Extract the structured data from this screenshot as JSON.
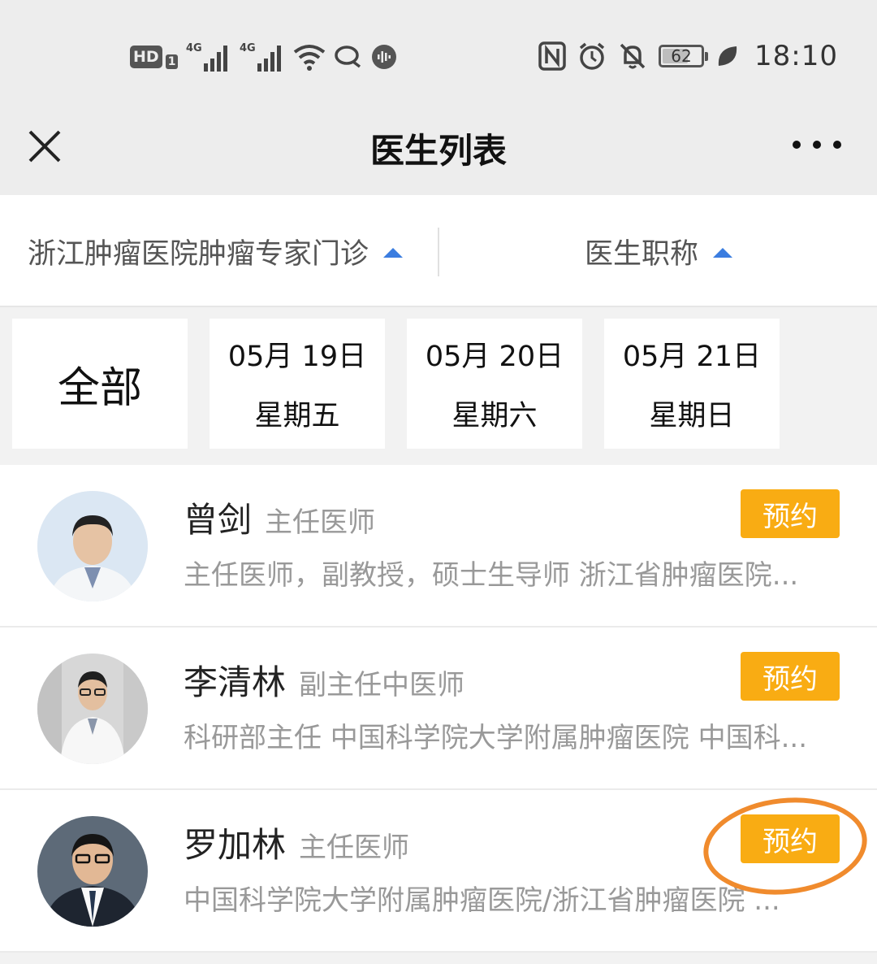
{
  "status_bar": {
    "hd": "HD",
    "sim": "1",
    "net1": "4G",
    "net2": "4G",
    "battery_level": "62",
    "time": "18:10",
    "icons_left": [
      "hd-icon",
      "signal-4g-icon",
      "signal-4g-icon",
      "wifi-icon",
      "chat-bubble-icon",
      "audio-icon"
    ],
    "icons_right": [
      "nfc-icon",
      "alarm-icon",
      "bell-muted-icon",
      "battery-icon",
      "leaf-icon"
    ]
  },
  "header": {
    "title": "医生列表"
  },
  "filters": {
    "hospital": "浙江肿瘤医院肿瘤专家门诊",
    "doctor_title": "医生职称",
    "accent_color": "#3b7de0"
  },
  "dates": {
    "all": "全部",
    "days": [
      {
        "date": "05月 19日",
        "weekday": "星期五"
      },
      {
        "date": "05月 20日",
        "weekday": "星期六"
      },
      {
        "date": "05月 21日",
        "weekday": "星期日"
      }
    ]
  },
  "doctors": [
    {
      "name": "曾剑",
      "title": "主任医师",
      "description": "主任医师，副教授，硕士生导师 浙江省肿瘤医院...",
      "action": "预约"
    },
    {
      "name": "李清林",
      "title": "副主任中医师",
      "description": "科研部主任 中国科学院大学附属肿瘤医院 中国科...",
      "action": "预约"
    },
    {
      "name": "罗加林",
      "title": "主任医师",
      "description": "中国科学院大学附属肿瘤医院/浙江省肿瘤医院 ...",
      "action": "预约"
    }
  ],
  "colors": {
    "book_button": "#f9ac13",
    "highlight_ring": "#f08b2d"
  }
}
